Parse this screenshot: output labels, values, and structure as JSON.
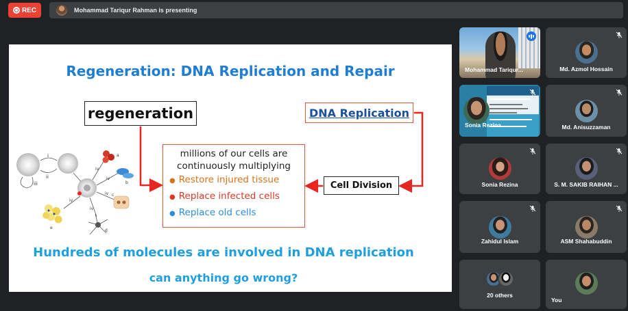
{
  "header": {
    "rec_label": "REC",
    "presenter_text": "Mohammad Tariqur Rahman is presenting"
  },
  "slide": {
    "title": "Regeneration: DNA Replication and Repair",
    "regeneration_label": "regeneration",
    "dna_replication_label": "DNA Replication",
    "cell_division_label": "Cell Division",
    "center_line1": "millions of our cells are",
    "center_line2": "continuously multiplying",
    "bullets": [
      {
        "text": "Restore injured tissue",
        "color": "#d9731b"
      },
      {
        "text": "Replace infected cells",
        "color": "#d63b25"
      },
      {
        "text": "Replace old cells",
        "color": "#2a8fd8"
      }
    ],
    "bottom_line1": "Hundreds of molecules are involved in DNA replication",
    "bottom_line2": "can anything go wrong?",
    "diagram_labels": [
      "i",
      "ii",
      "iii",
      "iv",
      "iv",
      "iv",
      "iv",
      "iv",
      "a",
      "b",
      "c",
      "d",
      "e"
    ],
    "accent_colors": {
      "title": "#1f7ed1",
      "arrow": "#e8261f",
      "bottom": "#1e9fe0"
    }
  },
  "participants": [
    {
      "name": "Mohammad Tariqur...",
      "state": "speaking"
    },
    {
      "name": "Md. Azmol Hossain",
      "state": "muted"
    },
    {
      "name": "Sonia Rezina",
      "state": "muted"
    },
    {
      "name": "Md. Anisuzzaman",
      "state": "muted"
    },
    {
      "name": "Sonia Rezina",
      "state": "muted"
    },
    {
      "name": "S. M. SAKIB RAIHAN ...",
      "state": "muted"
    },
    {
      "name": "Zahidul Islam",
      "state": "muted"
    },
    {
      "name": "ASM Shahabuddin",
      "state": "muted"
    },
    {
      "name": "20 others",
      "state": "group"
    },
    {
      "name": "You",
      "state": "muted"
    }
  ],
  "icons": [
    "record-icon",
    "muted-mic-icon",
    "speaking-indicator-icon"
  ]
}
